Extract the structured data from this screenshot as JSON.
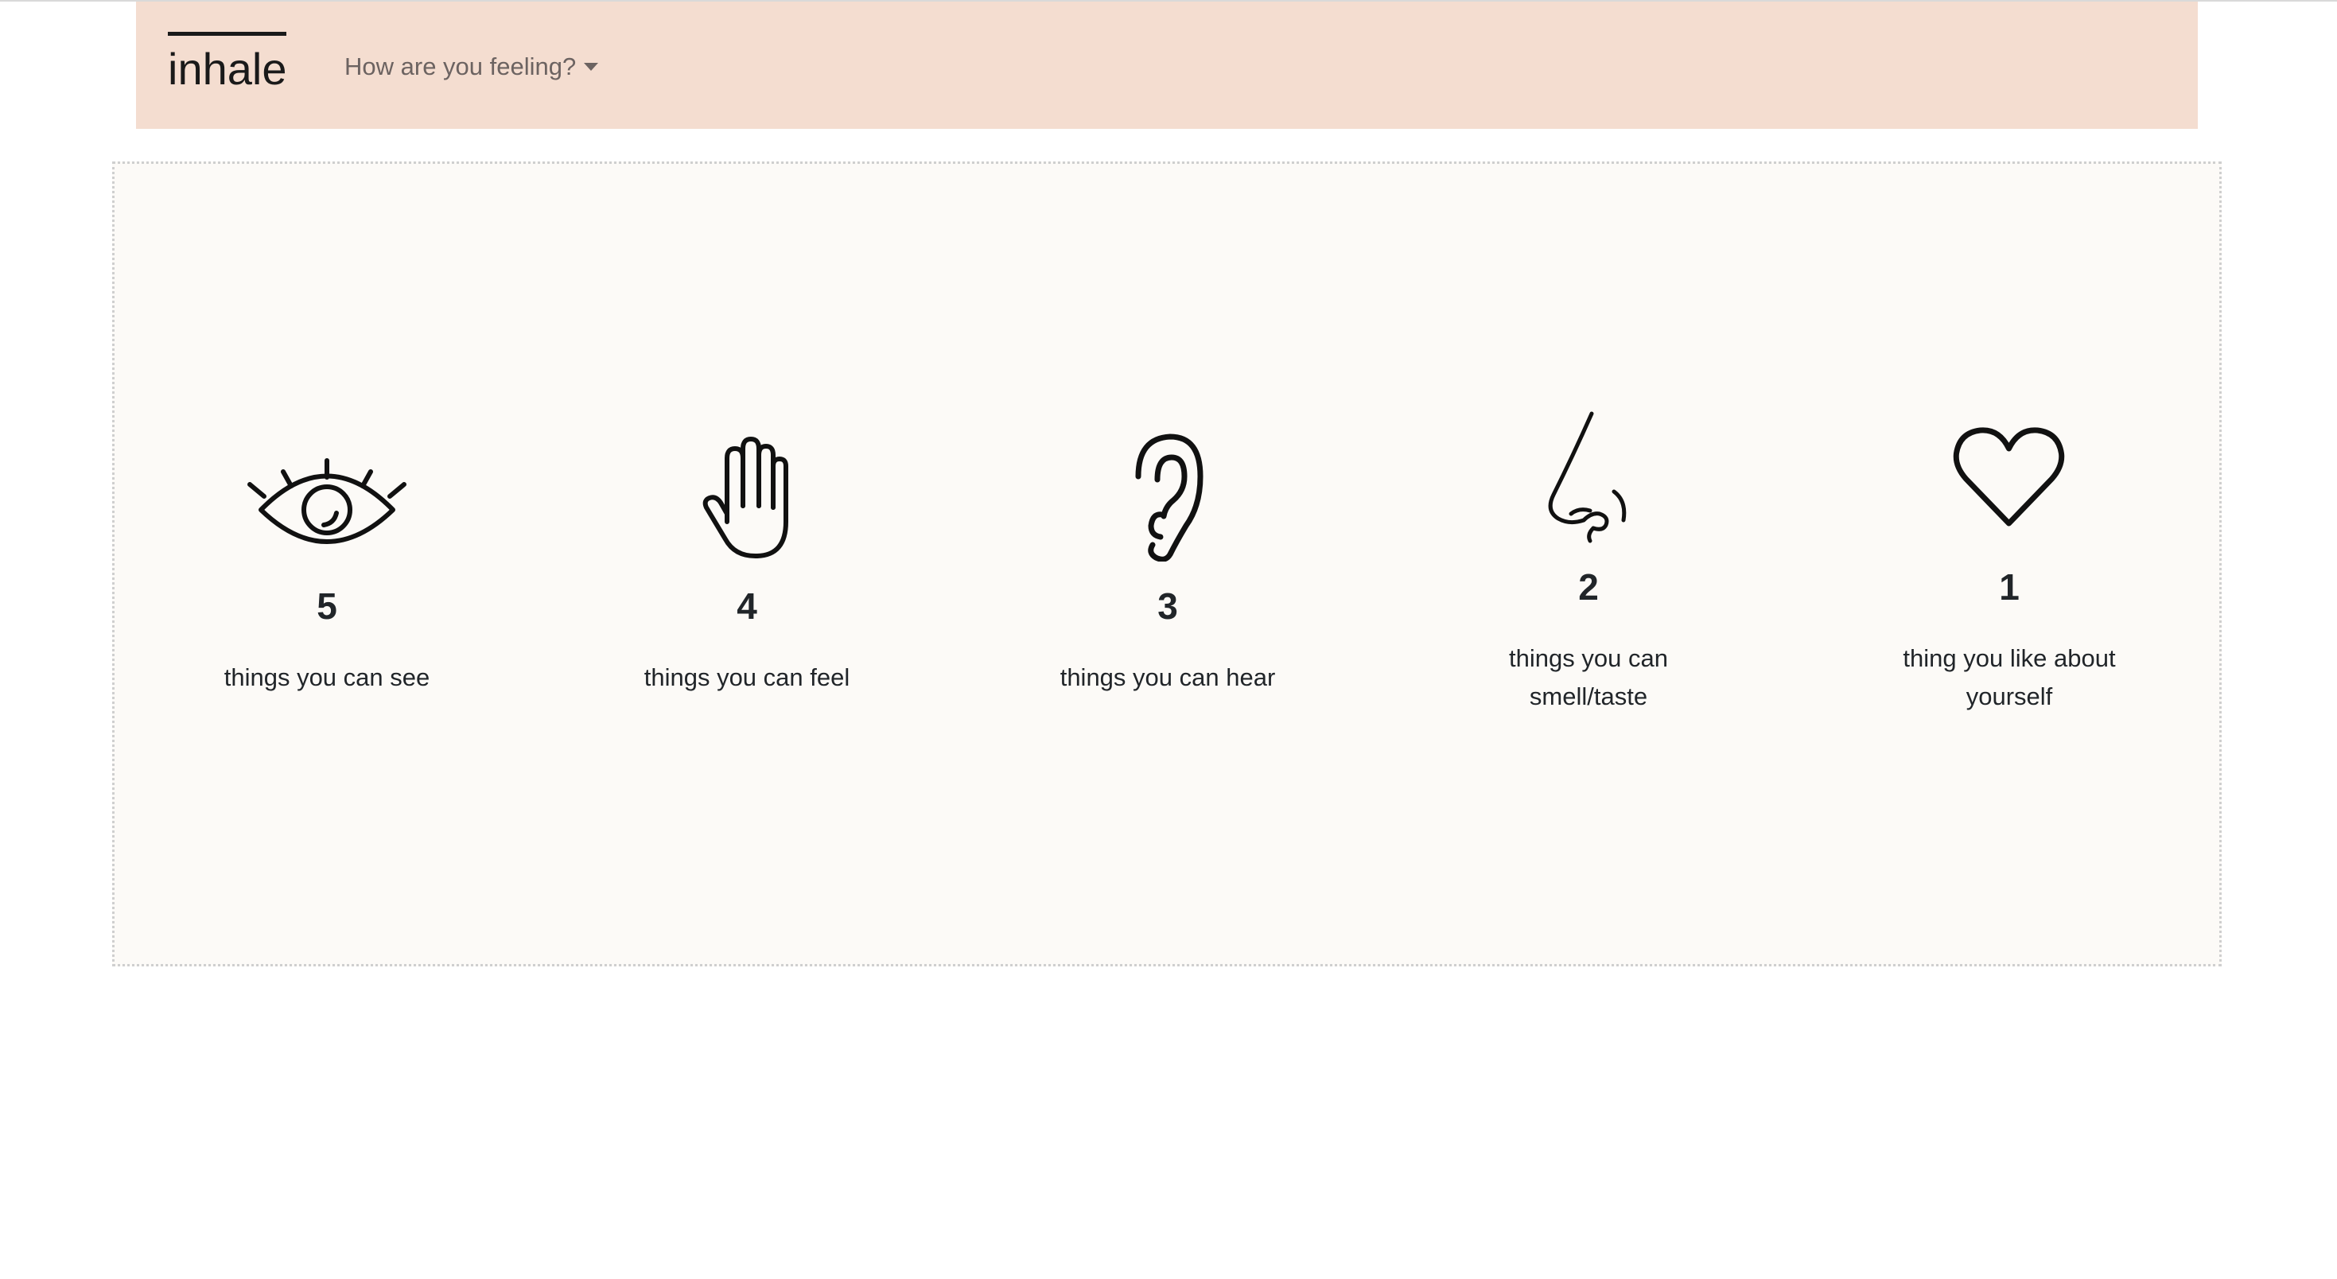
{
  "navbar": {
    "brand": "inhale",
    "dropdown_label": "How are you feeling?"
  },
  "grounding": {
    "items": [
      {
        "icon": "eye-icon",
        "count": "5",
        "text": "things you can see"
      },
      {
        "icon": "hand-icon",
        "count": "4",
        "text": "things you can feel"
      },
      {
        "icon": "ear-icon",
        "count": "3",
        "text": "things you can hear"
      },
      {
        "icon": "nose-icon",
        "count": "2",
        "text": "things you can smell/taste"
      },
      {
        "icon": "heart-icon",
        "count": "1",
        "text": "thing you like about yourself"
      }
    ]
  },
  "colors": {
    "navbar_bg": "#f4ddd0",
    "panel_bg": "#fcfaf7",
    "text": "#212529"
  }
}
